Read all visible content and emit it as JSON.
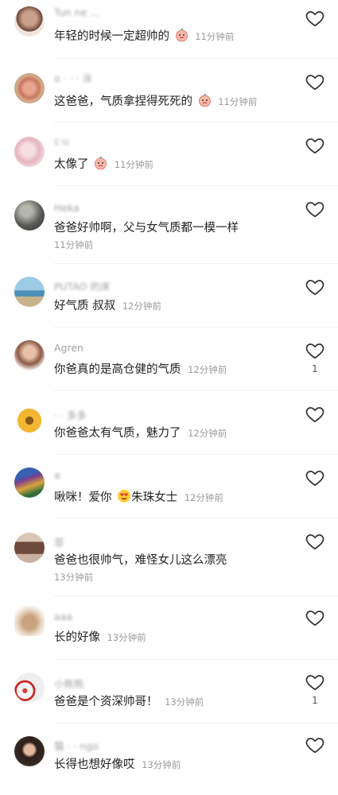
{
  "comments": [
    {
      "username": "Tun ne ... ",
      "text": "年轻的时候一定超帅的",
      "emoji": "peach-face",
      "time": "11分钟前",
      "avatar": "avatar-child-photo",
      "likes": ""
    },
    {
      "username": "o · · · 泳",
      "text": "这爸爸，气质拿捏得死死的",
      "emoji": "peach-face",
      "time": "11分钟前",
      "avatar": "avatar-rose-photo",
      "likes": ""
    },
    {
      "username": "  c·u",
      "text": "太像了",
      "emoji": "peach-face",
      "time": "11分钟前",
      "avatar": "avatar-pink-sketch",
      "likes": ""
    },
    {
      "username": "Heka",
      "text": "爸爸好帅啊，父与女气质都一模一样",
      "emoji": "",
      "time": "11分钟前",
      "avatar": "avatar-dark-photo",
      "likes": ""
    },
    {
      "username": "PUTAO 的床",
      "text": "好气质 叔叔",
      "emoji": "",
      "time": "12分钟前",
      "avatar": "avatar-palm-beach",
      "likes": ""
    },
    {
      "username": "Agren",
      "text": "你爸真的是高仓健的气质",
      "emoji": "",
      "time": "12分钟前",
      "avatar": "avatar-girl-photo",
      "likes": "1"
    },
    {
      "username": "· · 多多",
      "text": "你爸爸太有气质，魅力了",
      "emoji": "",
      "time": "12分钟前",
      "avatar": "avatar-sunflower",
      "likes": ""
    },
    {
      "username": "        a",
      "text": "啾咪！爱你",
      "emoji": "heart-eyes",
      "text_after": "朱珠女士",
      "time": "12分钟前",
      "avatar": "avatar-painting",
      "likes": ""
    },
    {
      "username": "菲",
      "text": "爸爸也很帅气，难怪女儿这么漂亮",
      "emoji": "",
      "time": "13分钟前",
      "avatar": "avatar-woman-hair",
      "likes": ""
    },
    {
      "username": "      aaa",
      "text": "长的好像",
      "emoji": "",
      "time": "13分钟前",
      "avatar": "avatar-teddy-bear",
      "likes": ""
    },
    {
      "username": "小熊熊",
      "text": "爸爸是个资深帅哥！",
      "emoji": "",
      "time": "13分钟前",
      "avatar": "avatar-red-flowers",
      "likes": "1"
    },
    {
      "username": "猫 · · ngo",
      "text": "长得也想好像哎",
      "emoji": "",
      "time": "13分钟前",
      "avatar": "avatar-long-hair",
      "likes": ""
    }
  ],
  "colors": {
    "text": "#222222",
    "meta": "#9b9b9b",
    "username": "#a3a3a3",
    "icon": "#333333",
    "divider": "#f1f1f1"
  }
}
